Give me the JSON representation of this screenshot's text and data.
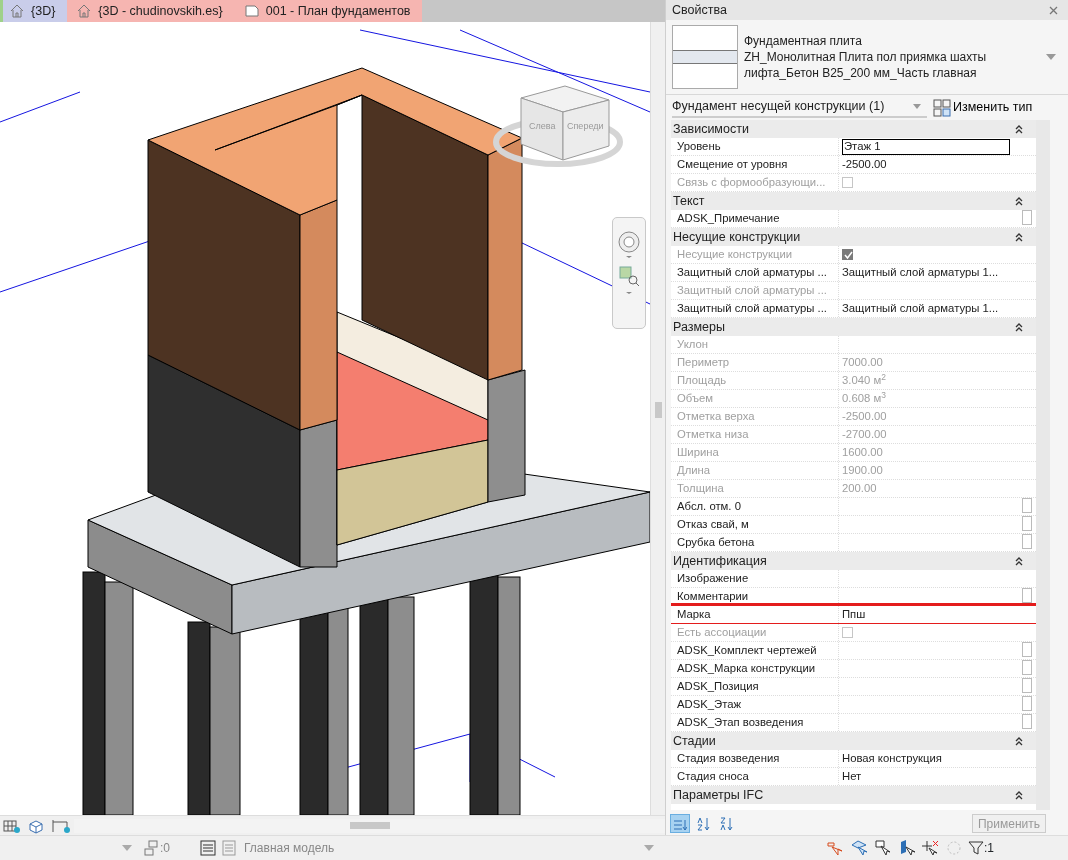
{
  "tabs": [
    {
      "label": "{3D}",
      "kind": "view",
      "selected": true,
      "color": "#c9cdea"
    },
    {
      "label": "{3D - chudinovskih.es}",
      "kind": "view",
      "selected": false,
      "color": "#f6b5b1"
    },
    {
      "label": "001 - План фундаментов",
      "kind": "sheet",
      "selected": false,
      "color": "#f6b5b1"
    }
  ],
  "viewcube": {
    "faces": [
      "Слева",
      "Спереди"
    ]
  },
  "properties": {
    "title": "Свойства",
    "type_lines": [
      "Фундаментная плита",
      "ZH_Монолитная Плита пол приямка шахты",
      "лифта_Бетон B25_200 мм_Часть главная"
    ],
    "instance_filter": "Фундамент несущей конструкции (1)",
    "edit_type": "Изменить тип",
    "groups": [
      {
        "title": "Зависимости",
        "expanded": true,
        "rows": [
          {
            "label": "Уровень",
            "kind": "input",
            "value": "Этаж 1",
            "disabled": false,
            "side_box": false,
            "highlighted": false
          },
          {
            "label": "Смещение от уровня",
            "kind": "text",
            "value": "-2500.00",
            "disabled": false,
            "side_box": false,
            "highlighted": false
          },
          {
            "label": "Связь с формообразующи...",
            "kind": "check",
            "checked": false,
            "disabled": true,
            "side_box": false,
            "highlighted": false
          }
        ]
      },
      {
        "title": "Текст",
        "expanded": true,
        "rows": [
          {
            "label": "ADSK_Примечание",
            "kind": "text",
            "value": "",
            "disabled": false,
            "side_box": true,
            "highlighted": false
          }
        ]
      },
      {
        "title": "Несущие конструкции",
        "expanded": true,
        "rows": [
          {
            "label": "Несущие конструкции",
            "kind": "check",
            "checked": true,
            "disabled": true,
            "side_box": false,
            "highlighted": false
          },
          {
            "label": "Защитный слой арматуры ...",
            "kind": "text",
            "value": "Защитный слой арматуры 1...",
            "disabled": false,
            "side_box": false,
            "highlighted": false
          },
          {
            "label": "Защитный слой арматуры ...",
            "kind": "text",
            "value": "",
            "disabled": true,
            "side_box": false,
            "highlighted": false
          },
          {
            "label": "Защитный слой арматуры ...",
            "kind": "text",
            "value": "Защитный слой арматуры 1...",
            "disabled": false,
            "side_box": false,
            "highlighted": false
          }
        ]
      },
      {
        "title": "Размеры",
        "expanded": true,
        "rows": [
          {
            "label": "Уклон",
            "kind": "text",
            "value": "",
            "disabled": true,
            "side_box": false,
            "highlighted": false
          },
          {
            "label": "Периметр",
            "kind": "text",
            "value": "7000.00",
            "disabled": true,
            "side_box": false,
            "highlighted": false
          },
          {
            "label": "Площадь",
            "kind": "text",
            "value": "3.040 м$^{2}$",
            "disabled": true,
            "side_box": false,
            "highlighted": false
          },
          {
            "label": "Объем",
            "kind": "text",
            "value": "0.608 м$^{3}$",
            "disabled": true,
            "side_box": false,
            "highlighted": false
          },
          {
            "label": "Отметка верха",
            "kind": "text",
            "value": "-2500.00",
            "disabled": true,
            "side_box": false,
            "highlighted": false
          },
          {
            "label": "Отметка низа",
            "kind": "text",
            "value": "-2700.00",
            "disabled": true,
            "side_box": false,
            "highlighted": false
          },
          {
            "label": "Ширина",
            "kind": "text",
            "value": "1600.00",
            "disabled": true,
            "side_box": false,
            "highlighted": false
          },
          {
            "label": "Длина",
            "kind": "text",
            "value": "1900.00",
            "disabled": true,
            "side_box": false,
            "highlighted": false
          },
          {
            "label": "Толщина",
            "kind": "text",
            "value": "200.00",
            "disabled": true,
            "side_box": false,
            "highlighted": false
          },
          {
            "label": "Абсл. отм. 0",
            "kind": "text",
            "value": "",
            "disabled": false,
            "side_box": true,
            "highlighted": false
          },
          {
            "label": "Отказ свай, м",
            "kind": "text",
            "value": "",
            "disabled": false,
            "side_box": true,
            "highlighted": false
          },
          {
            "label": "Срубка бетона",
            "kind": "text",
            "value": "",
            "disabled": false,
            "side_box": true,
            "highlighted": false
          }
        ]
      },
      {
        "title": "Идентификация",
        "expanded": true,
        "rows": [
          {
            "label": "Изображение",
            "kind": "text",
            "value": "",
            "disabled": false,
            "side_box": false,
            "highlighted": false
          },
          {
            "label": "Комментарии",
            "kind": "text",
            "value": "",
            "disabled": false,
            "side_box": true,
            "highlighted": false
          },
          {
            "label": "Марка",
            "kind": "text",
            "value": "Ппш",
            "disabled": false,
            "side_box": false,
            "highlighted": true
          },
          {
            "label": "Есть ассоциации",
            "kind": "check",
            "checked": false,
            "disabled": true,
            "side_box": false,
            "highlighted": false
          },
          {
            "label": "ADSK_Комплект чертежей",
            "kind": "text",
            "value": "",
            "disabled": false,
            "side_box": true,
            "highlighted": false
          },
          {
            "label": "ADSK_Марка конструкции",
            "kind": "text",
            "value": "",
            "disabled": false,
            "side_box": true,
            "highlighted": false
          },
          {
            "label": "ADSK_Позиция",
            "kind": "text",
            "value": "",
            "disabled": false,
            "side_box": true,
            "highlighted": false
          },
          {
            "label": "ADSK_Этаж",
            "kind": "text",
            "value": "",
            "disabled": false,
            "side_box": true,
            "highlighted": false
          },
          {
            "label": "ADSK_Этап возведения",
            "kind": "text",
            "value": "",
            "disabled": false,
            "side_box": true,
            "highlighted": false
          }
        ]
      },
      {
        "title": "Стадии",
        "expanded": true,
        "rows": [
          {
            "label": "Стадия возведения",
            "kind": "text",
            "value": "Новая конструкция",
            "disabled": false,
            "side_box": false,
            "highlighted": false
          },
          {
            "label": "Стадия сноса",
            "kind": "text",
            "value": "Нет",
            "disabled": false,
            "side_box": false,
            "highlighted": false
          }
        ]
      },
      {
        "title": "Параметры IFC",
        "expanded": true
      }
    ],
    "apply": "Применить"
  },
  "status_bar": {
    "worksets": ":0",
    "model": "Главная модель",
    "filters": ":1"
  }
}
